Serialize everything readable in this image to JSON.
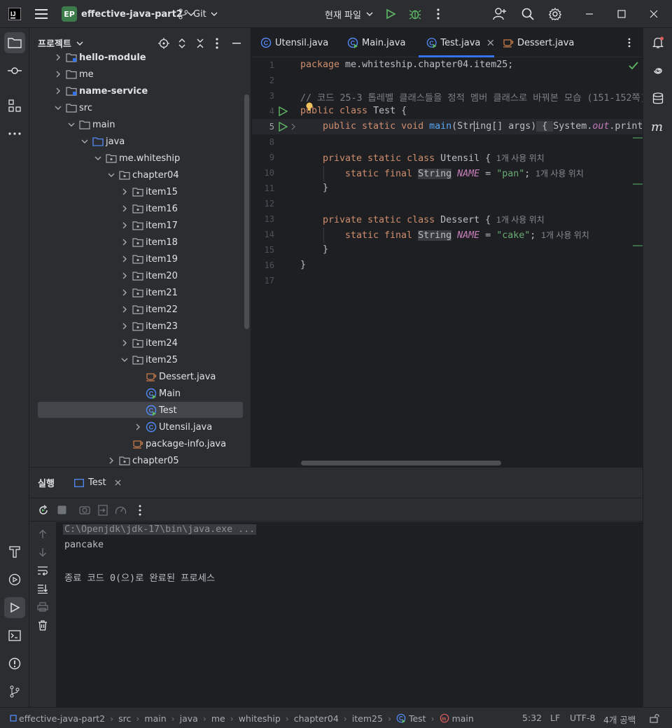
{
  "titlebar": {
    "project_badge": "EP",
    "project_name": "effective-java-part2",
    "vcs": "Git",
    "run_config": "현재 파일"
  },
  "project_panel": {
    "title": "프로젝트",
    "tree": [
      {
        "label": "hello-module",
        "bold": true
      },
      {
        "label": "me",
        "bold": false
      },
      {
        "label": "name-service",
        "bold": true
      },
      {
        "label": "src",
        "bold": false
      },
      {
        "label": "main",
        "bold": false
      },
      {
        "label": "java",
        "bold": false
      },
      {
        "label": "me.whiteship",
        "bold": false
      },
      {
        "label": "chapter04",
        "bold": false
      },
      {
        "label": "item15"
      },
      {
        "label": "item16"
      },
      {
        "label": "item17"
      },
      {
        "label": "item18"
      },
      {
        "label": "item19"
      },
      {
        "label": "item20"
      },
      {
        "label": "item21"
      },
      {
        "label": "item22"
      },
      {
        "label": "item23"
      },
      {
        "label": "item24"
      },
      {
        "label": "item25"
      },
      {
        "label": "Dessert.java"
      },
      {
        "label": "Main"
      },
      {
        "label": "Test"
      },
      {
        "label": "Utensil.java"
      },
      {
        "label": "package-info.java"
      },
      {
        "label": "chapter05"
      }
    ]
  },
  "editor": {
    "tabs": [
      {
        "label": "Utensil.java"
      },
      {
        "label": "Main.java"
      },
      {
        "label": "Test.java"
      },
      {
        "label": "Dessert.java"
      }
    ],
    "line_numbers": [
      "1",
      "2",
      "3",
      "4",
      "5",
      "8",
      "9",
      "10",
      "11",
      "12",
      "13",
      "14",
      "15",
      "16",
      "17"
    ],
    "lines": {
      "l1_kw": "package",
      "l1_rest": " me.whiteship.chapter04.item25;",
      "l3": "// 코드 25-3 톱레벨 클래스들을 정적 멤버 클래스로 바꿔본 모습 (151-152쪽)",
      "l4_kw": "public class",
      "l4_rest": " Test {",
      "l5_kw": "public static void",
      "l5_fn": "main",
      "l5_rest1": "(Str",
      "l5_rest2": "ing[] args)",
      "l5_fold": " { ",
      "l5_rest3": "System.",
      "l5_out": "out",
      "l5_rest4": ".println(Utensil.NAME + Dessert.NAME); }",
      "l9_kw": "private static class",
      "l9_rest": " Utensil {",
      "usage_hint": "1개 사용 위치",
      "l10_kw": "static final",
      "l10_type": "String",
      "l10_name": "NAME",
      "l10_eq": " = ",
      "l10_str": "\"pan\"",
      "l10_semi": ";",
      "l11": "}",
      "l13_kw": "private static class",
      "l13_rest": " Dessert {",
      "l14_kw": "static final",
      "l14_type": "String",
      "l14_name": "NAME",
      "l14_eq": " = ",
      "l14_str": "\"cake\"",
      "l14_semi": ";",
      "l15": "}",
      "l16": "}"
    }
  },
  "run_panel": {
    "title": "실행",
    "tab": "Test",
    "output": [
      "C:\\Openjdk\\jdk-17\\bin\\java.exe ...",
      "pancake",
      "",
      "종료 코드 0(으)로 완료된 프로세스"
    ]
  },
  "statusbar": {
    "crumbs": [
      "effective-java-part2",
      "src",
      "main",
      "java",
      "me",
      "whiteship",
      "chapter04",
      "item25",
      "Test",
      "main"
    ],
    "position": "5:32",
    "line_sep": "LF",
    "encoding": "UTF-8",
    "indent": "4개 공백"
  },
  "colors": {
    "accent": "#3574f0",
    "bg_editor": "#1e1f22",
    "bg_panel": "#2b2d30",
    "keyword": "#cf8e6d",
    "string": "#6aab73",
    "function": "#56a8f5",
    "run_green": "#5fb865"
  }
}
